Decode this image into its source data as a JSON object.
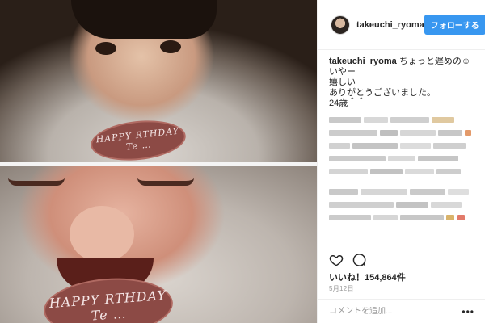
{
  "header": {
    "username": "takeuchi_ryoma",
    "follow_label": "フォローする"
  },
  "photo": {
    "plaque_top_line1": "HAPPY   RTHDAY",
    "plaque_top_line2": "Te  …",
    "plaque_bottom_line1": "HAPPY   RTHDAY",
    "plaque_bottom_line2": "Te  …"
  },
  "caption": {
    "username": "takeuchi_ryoma",
    "line1": "ちょっと遅めの☺ いやー",
    "line2": "嬉しい",
    "line3": "ありがとうございました。",
    "line4": "24歳＾＾"
  },
  "actions": {
    "like_icon": "heart-icon",
    "comment_icon": "comment-icon"
  },
  "likes_text": "いいね！154,864件",
  "date_text": "5月12日",
  "comment": {
    "placeholder": "コメントを追加..."
  },
  "colors": {
    "follow_button": "#3897f0",
    "border": "#efefef"
  }
}
